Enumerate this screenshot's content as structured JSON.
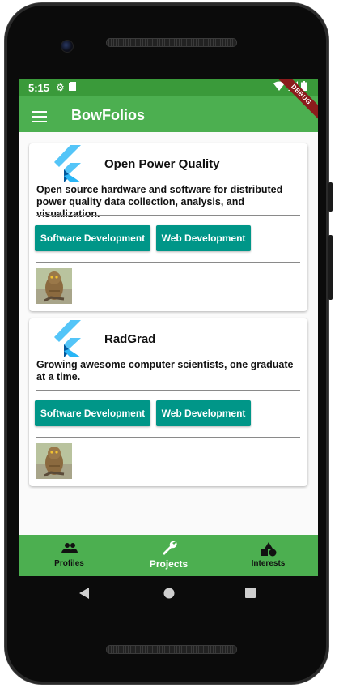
{
  "status_bar": {
    "time": "5:15"
  },
  "app_bar": {
    "title": "BowFolios",
    "debug_banner": "DEBUG"
  },
  "projects": [
    {
      "name": "Open Power Quality",
      "description": "Open source hardware and software for distributed power quality data collection, analysis, and visualization.",
      "interests": [
        "Software Development",
        "Web Development"
      ]
    },
    {
      "name": "RadGrad",
      "description": "Growing awesome computer scientists, one graduate at a time.",
      "interests": [
        "Software Development",
        "Web Development"
      ]
    }
  ],
  "bottom_nav": {
    "items": [
      {
        "label": "Profiles",
        "icon": "people-icon"
      },
      {
        "label": "Projects",
        "icon": "wrench-icon"
      },
      {
        "label": "Interests",
        "icon": "shapes-icon"
      }
    ],
    "active": "Projects"
  },
  "colors": {
    "primary": "#4caf50",
    "status_bar": "#3a9a3a",
    "chip": "#009688",
    "debug_banner": "#8b1c1c"
  }
}
